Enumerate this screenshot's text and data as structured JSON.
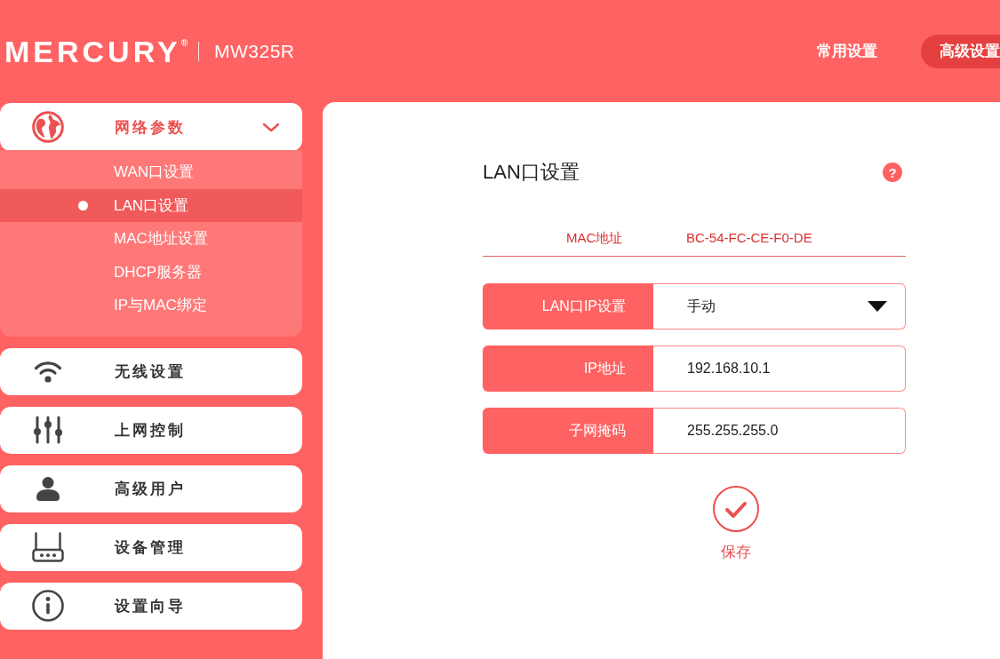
{
  "header": {
    "logo": "MERCURY$^{®}$",
    "model": "MW325R",
    "tabs": [
      {
        "label": "常用设置",
        "selected": false
      },
      {
        "label": "高级设置",
        "selected": true
      }
    ]
  },
  "sidebar": {
    "items": [
      {
        "label": "网络参数",
        "selected": true,
        "expanded": true,
        "children": [
          {
            "label": "WAN口设置",
            "selected": false
          },
          {
            "label": "LAN口设置",
            "selected": true
          },
          {
            "label": "MAC地址设置",
            "selected": false
          },
          {
            "label": "DHCP服务器",
            "selected": false
          },
          {
            "label": "IP与MAC绑定",
            "selected": false
          }
        ]
      },
      {
        "label": "无线设置",
        "selected": false
      },
      {
        "label": "上网控制",
        "selected": false
      },
      {
        "label": "高级用户",
        "selected": false
      },
      {
        "label": "设备管理",
        "selected": false
      },
      {
        "label": "设置向导",
        "selected": false
      }
    ]
  },
  "content": {
    "title": "LAN口设置",
    "help": "?",
    "mac": {
      "label": "MAC地址",
      "value": "BC-54-FC-CE-F0-DE"
    },
    "fields": [
      {
        "kind": "select",
        "label": "LAN口IP设置",
        "value": "手动"
      },
      {
        "kind": "text",
        "label": "IP地址",
        "value": "192.168.10.1"
      },
      {
        "kind": "text",
        "label": "子网掩码",
        "value": "255.255.255.0"
      }
    ],
    "save_button": {
      "label": "保存"
    }
  }
}
